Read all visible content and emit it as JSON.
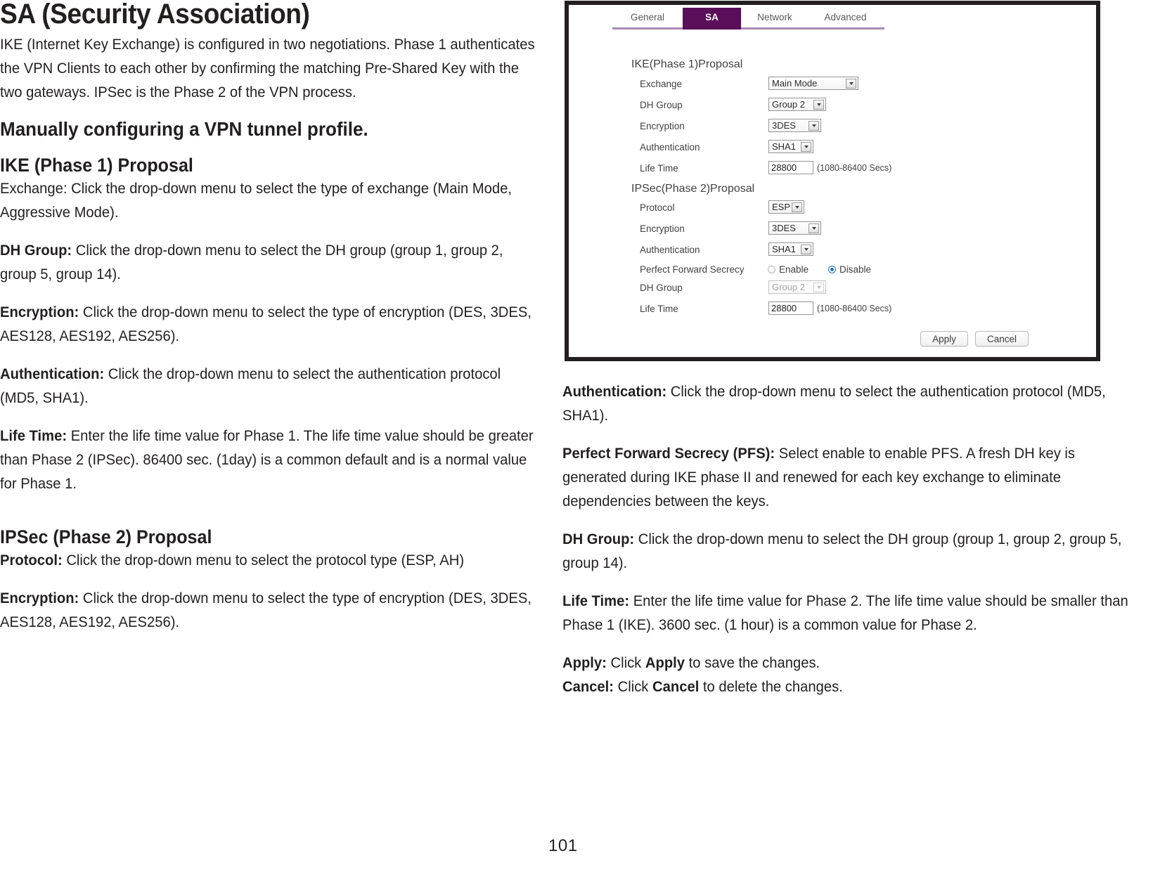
{
  "page": {
    "number": "101"
  },
  "left_column": {
    "title": "SA (Security Association)",
    "intro": "IKE (Internet Key Exchange) is configured in two negotiations. Phase 1 authenticates the VPN Clients to each other by confirming the matching Pre-Shared Key with the two gateways. IPSec is the Phase 2 of the VPN process.",
    "subtitle": "Manually configuring a VPN tunnel profile.",
    "section1_heading": "IKE (Phase 1) Proposal",
    "exchange_text": "Exchange: Click the drop-down menu to select the type of exchange (Main Mode, Aggressive Mode).",
    "dh_group_label": "DH Group:",
    "dh_group_text": " Click the drop-down menu to select the DH group (group 1, group 2, group 5, group 14).",
    "encryption_label": "Encryption:",
    "encryption_text": " Click the drop-down menu to select the type of encryption (DES, 3DES, AES128, AES192, AES256).",
    "authentication_label": "Authentication:",
    "authentication_text": " Click the drop-down menu to select the authentication protocol (MD5, SHA1).",
    "life_time_label": "Life Time:",
    "life_time_text": " Enter the life time value for Phase 1. The life time value should be greater than Phase 2 (IPSec). 86400 sec. (1day) is a common default and is a normal value for Phase 1.",
    "section2_heading": "IPSec (Phase 2) Proposal",
    "protocol_label": "Protocol:",
    "protocol_text": " Click the drop-down menu to select the protocol type (ESP, AH)",
    "encryption2_label": "Encryption:",
    "encryption2_text": " Click the drop-down menu to select the type of encryption (DES, 3DES, AES128, AES192, AES256)."
  },
  "right_column": {
    "authentication_label": "Authentication:",
    "authentication_text": " Click the drop-down menu to select the authentication protocol (MD5, SHA1).",
    "pfs_label": "Perfect Forward Secrecy (PFS):",
    "pfs_text": " Select enable to enable PFS. A fresh DH key is generated during IKE phase II and renewed for each key exchange to eliminate dependencies between the keys.",
    "dh_group_label": "DH Group:",
    "dh_group_text": " Click the drop-down menu to select the DH group (group 1, group 2, group 5, group 14).",
    "life_time_label": "Life Time:",
    "life_time_text": " Enter the life time value for Phase 2. The life time value should be smaller than Phase 1 (IKE). 3600 sec. (1 hour) is a common value for Phase 2.",
    "apply_label": "Apply:",
    "apply_text_1": " Click ",
    "apply_bold": "Apply",
    "apply_text_2": " to save the changes.",
    "cancel_label": "Cancel:",
    "cancel_text_1": " Click ",
    "cancel_bold": "Cancel",
    "cancel_text_2": " to delete the changes."
  },
  "screenshot": {
    "tabs": [
      {
        "label": "General",
        "active": false
      },
      {
        "label": "SA",
        "active": true
      },
      {
        "label": "Network",
        "active": false
      },
      {
        "label": "Advanced",
        "active": false
      }
    ],
    "active_tab_color": "#5a0e5a",
    "underline_color": "#a98ab5",
    "phase1": {
      "title": "IKE(Phase 1)Proposal",
      "fields": [
        {
          "label": "Exchange",
          "control": "dropdown",
          "value": "Main Mode"
        },
        {
          "label": "DH Group",
          "control": "dropdown",
          "value": "Group 2"
        },
        {
          "label": "Encryption",
          "control": "dropdown",
          "value": "3DES"
        },
        {
          "label": "Authentication",
          "control": "dropdown",
          "value": "SHA1"
        },
        {
          "label": "Life Time",
          "control": "textbox",
          "value": "28800",
          "hint": "(1080-86400 Secs)"
        }
      ]
    },
    "phase2": {
      "title": "IPSec(Phase 2)Proposal",
      "fields": [
        {
          "label": "Protocol",
          "control": "dropdown",
          "value": "ESP"
        },
        {
          "label": "Encryption",
          "control": "dropdown",
          "value": "3DES"
        },
        {
          "label": "Authentication",
          "control": "dropdown",
          "value": "SHA1"
        },
        {
          "label": "Perfect Forward Secrecy",
          "control": "radio",
          "options": [
            "Enable",
            "Disable"
          ],
          "selected": "Disable"
        },
        {
          "label": "DH Group",
          "control": "dropdown",
          "value": "Group 2",
          "disabled": true
        },
        {
          "label": "Life Time",
          "control": "textbox",
          "value": "28800",
          "hint": "(1080-86400 Secs)"
        }
      ]
    },
    "buttons": {
      "apply": "Apply",
      "cancel": "Cancel"
    }
  }
}
